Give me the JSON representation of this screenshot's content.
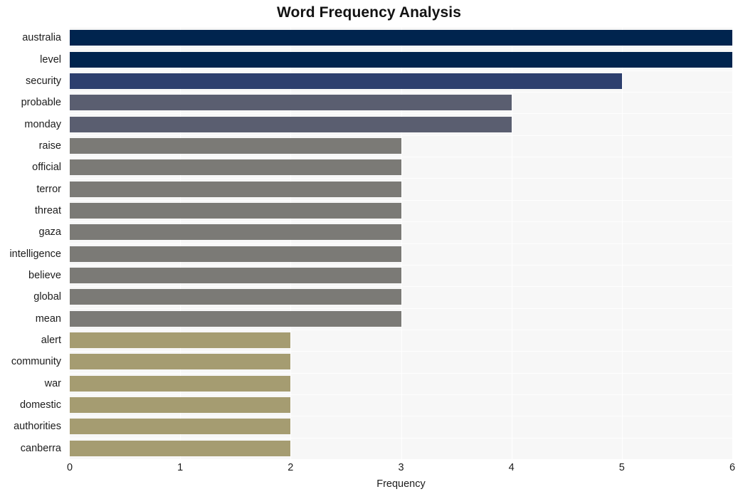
{
  "chart_data": {
    "type": "bar",
    "orientation": "horizontal",
    "title": "Word Frequency Analysis",
    "xlabel": "Frequency",
    "ylabel": "",
    "xlim": [
      0,
      6
    ],
    "xticks": [
      0,
      1,
      2,
      3,
      4,
      5,
      6
    ],
    "xtick_labels": [
      "0",
      "1",
      "2",
      "3",
      "4",
      "5",
      "6"
    ],
    "grid": true,
    "legend": "none",
    "categories": [
      "australia",
      "level",
      "security",
      "probable",
      "monday",
      "raise",
      "official",
      "terror",
      "threat",
      "gaza",
      "intelligence",
      "believe",
      "global",
      "mean",
      "alert",
      "community",
      "war",
      "domestic",
      "authorities",
      "canberra"
    ],
    "values": [
      6,
      6,
      5,
      4,
      4,
      3,
      3,
      3,
      3,
      3,
      3,
      3,
      3,
      3,
      2,
      2,
      2,
      2,
      2,
      2
    ],
    "bar_colors": [
      "#00244e",
      "#00244e",
      "#2d3f6e",
      "#5a5e70",
      "#5a5e70",
      "#7b7a76",
      "#7b7a76",
      "#7b7a76",
      "#7b7a76",
      "#7b7a76",
      "#7b7a76",
      "#7b7a76",
      "#7b7a76",
      "#7b7a76",
      "#a59c71",
      "#a59c71",
      "#a59c71",
      "#a59c71",
      "#a59c71",
      "#a59c71"
    ]
  },
  "style": {
    "plot_background": "#f7f7f7",
    "figure_background": "#ffffff",
    "gridline_color": "#ffffff",
    "text_color": "#1c1c1c",
    "title_color": "#121212"
  }
}
